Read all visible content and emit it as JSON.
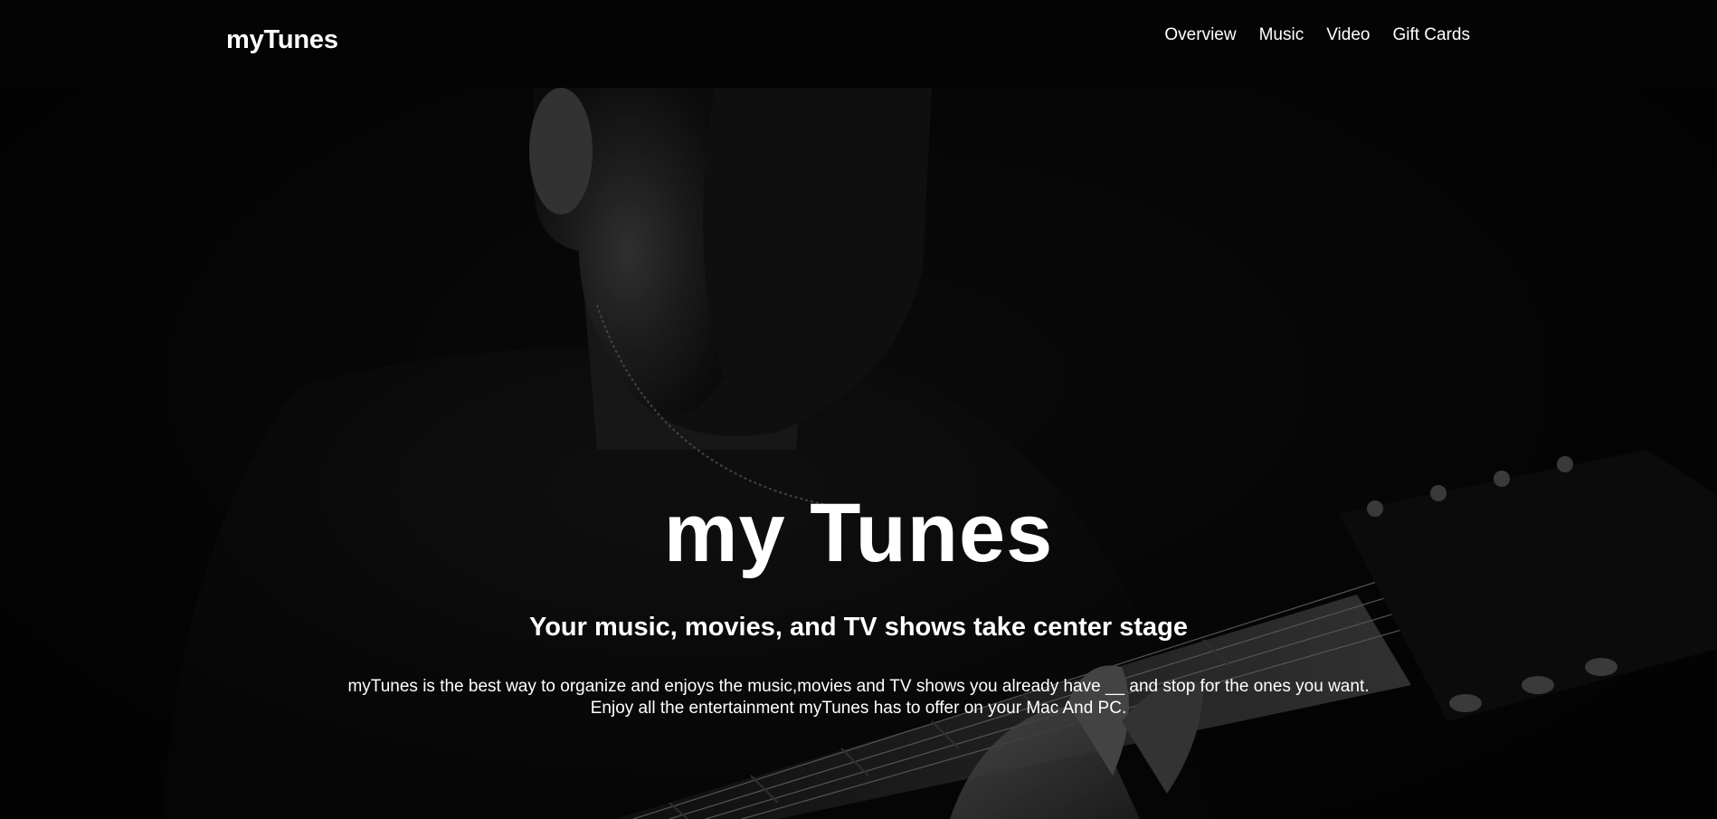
{
  "navbar": {
    "brand": "myTunes",
    "links": [
      "Overview",
      "Music",
      "Video",
      "Gift Cards"
    ]
  },
  "hero": {
    "title": "my Tunes",
    "subtitle": "Your music, movies, and TV shows take center stage",
    "description_line1": "myTunes is the best way to organize and enjoys the music,movies and TV shows you already have __ and stop for the ones you want.",
    "description_line2": "Enjoy all the entertainment myTunes has to offer on your Mac And PC.",
    "background_image": "guitarist-photo"
  },
  "colors": {
    "navbar_bg": "#040404",
    "text": "#ffffff",
    "hero_bg": "#0b0b0b"
  }
}
